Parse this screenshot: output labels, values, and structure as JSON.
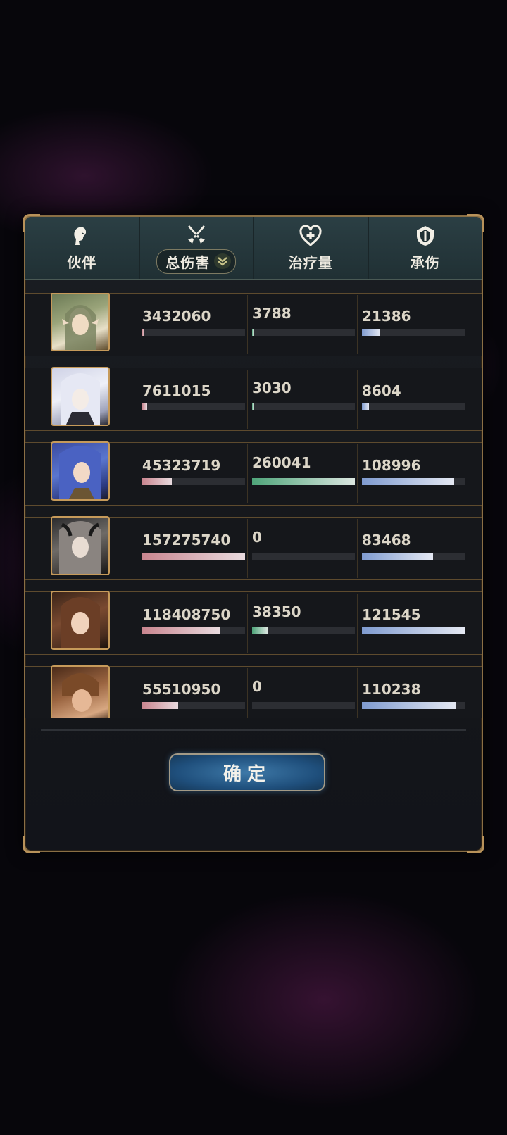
{
  "header": {
    "tabs": [
      {
        "label": "伙伴",
        "icon": "partner-icon"
      },
      {
        "label": "总伤害",
        "icon": "crossed-swords-icon",
        "active": true
      },
      {
        "label": "治疗量",
        "icon": "heart-plus-icon"
      },
      {
        "label": "承伤",
        "icon": "shield-icon"
      }
    ]
  },
  "rows": [
    {
      "damage": "3432060",
      "damage_ratio": 0.02,
      "heal": "3788",
      "heal_ratio": 0.015,
      "taken": "21386",
      "taken_ratio": 0.18
    },
    {
      "damage": "7611015",
      "damage_ratio": 0.05,
      "heal": "3030",
      "heal_ratio": 0.012,
      "taken": "8604",
      "taken_ratio": 0.07
    },
    {
      "damage": "45323719",
      "damage_ratio": 0.29,
      "heal": "260041",
      "heal_ratio": 1.0,
      "taken": "108996",
      "taken_ratio": 0.9
    },
    {
      "damage": "157275740",
      "damage_ratio": 1.0,
      "heal": "0",
      "heal_ratio": 0,
      "taken": "83468",
      "taken_ratio": 0.69
    },
    {
      "damage": "118408750",
      "damage_ratio": 0.75,
      "heal": "38350",
      "heal_ratio": 0.15,
      "taken": "121545",
      "taken_ratio": 1.0
    },
    {
      "damage": "55510950",
      "damage_ratio": 0.35,
      "heal": "0",
      "heal_ratio": 0,
      "taken": "110238",
      "taken_ratio": 0.91
    }
  ],
  "colors": {
    "damage_bar": "#c9858f",
    "heal_bar": "#4fa57a",
    "taken_bar": "#7f9bd0",
    "frame_gold": "#b8925a"
  },
  "confirm_label": "确定"
}
